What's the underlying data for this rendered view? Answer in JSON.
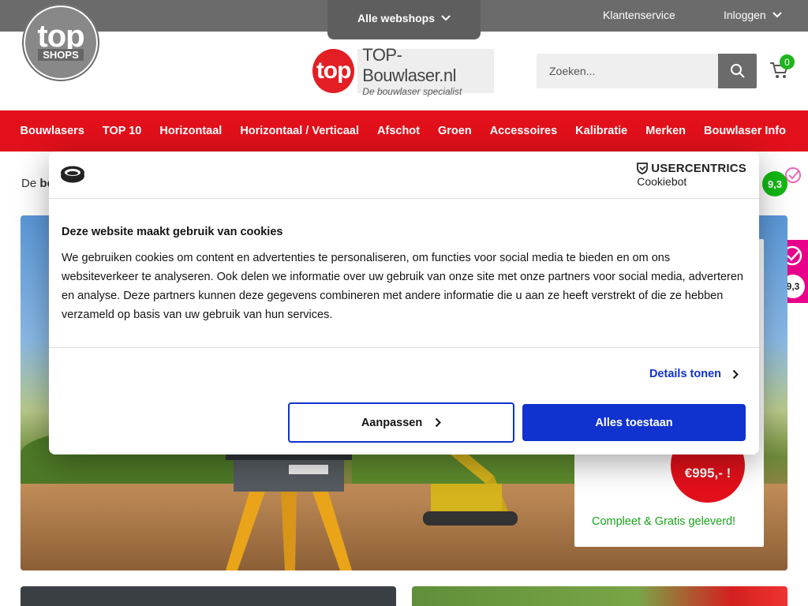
{
  "header": {
    "webshops_label": "Alle webshops",
    "customer_service": "Klantenservice",
    "login": "Inloggen",
    "topshops_top": "top",
    "topshops_shops": "SHOPS",
    "brand_circle": "top",
    "brand_name": "TOP-Bouwlaser.nl",
    "brand_tagline": "De bouwlaser specialist",
    "search_placeholder": "Zoeken...",
    "cart_count": "0"
  },
  "nav": {
    "items": [
      "Bouwlasers",
      "TOP 10",
      "Horizontaal",
      "Horizontaal / Verticaal",
      "Afschot",
      "Groen",
      "Accessoires",
      "Kalibratie",
      "Merken",
      "Bouwlaser Info"
    ]
  },
  "breadcrumb": {
    "prefix": "De",
    "bold": "be"
  },
  "rating": {
    "score": "9,3",
    "side_score": "9,3"
  },
  "hero": {
    "price": "€995,- !",
    "delivery": "Compleet & Gratis geleverd!"
  },
  "cookie": {
    "provider_title": "USERCENTRICS",
    "provider_sub": "Cookiebot",
    "title": "Deze website maakt gebruik van cookies",
    "body": "We gebruiken cookies om content en advertenties te personaliseren, om functies voor social media te bieden en om ons websiteverkeer te analyseren. Ook delen we informatie over uw gebruik van onze site met onze partners voor social media, adverteren en analyse. Deze partners kunnen deze gegevens combineren met andere informatie die u aan ze heeft verstrekt of die ze hebben verzameld op basis van uw gebruik van hun services.",
    "details": "Details tonen",
    "customize": "Aanpassen",
    "allow_all": "Alles toestaan"
  },
  "colors": {
    "nav_red": "#e2101b",
    "topbar_grey": "#6b6b6b",
    "cookie_blue": "#1032cf",
    "green": "#12b812",
    "kiyoh_pink": "#e8008a"
  }
}
